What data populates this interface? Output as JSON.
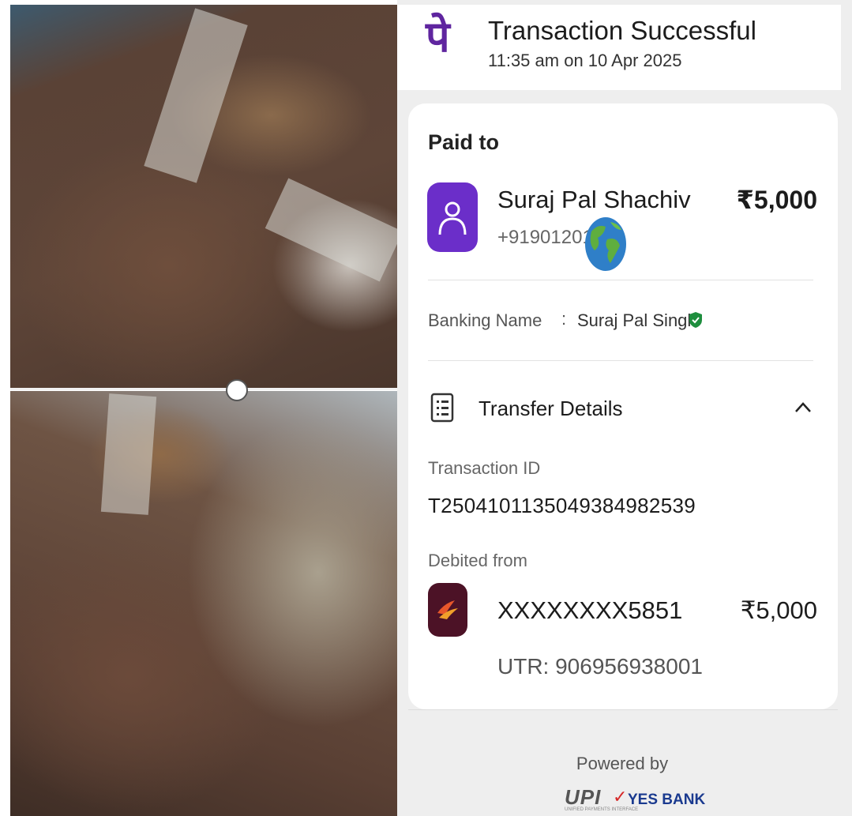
{
  "header": {
    "logo_glyph": "पे",
    "title": "Transaction Successful",
    "timestamp": "11:35 am on 10 Apr 2025"
  },
  "paid_to": {
    "label": "Paid to",
    "name": "Suraj Pal Shachiv",
    "phone": "+91901201",
    "amount": "₹5,000",
    "banking_name_label": "Banking Name",
    "banking_name_colon": ":",
    "banking_name_value": "Suraj Pal Singh"
  },
  "transfer_details": {
    "title": "Transfer Details",
    "transaction_id_label": "Transaction ID",
    "transaction_id": "T2504101135049384982539",
    "debited_from_label": "Debited from",
    "account": "XXXXXXXX5851",
    "amount": "₹5,000",
    "utr": "UTR: 906956938001"
  },
  "footer": {
    "powered_by": "Powered by",
    "upi": "UPI",
    "upi_sub": "UNIFIED PAYMENTS INTERFACE",
    "bank": "YES BANK"
  },
  "colors": {
    "brand_purple": "#5f259f",
    "avatar_purple": "#6b2ec9",
    "verified_green": "#1e8e3e",
    "bank_maroon": "#4c1226"
  },
  "icons": [
    "phonepe-logo",
    "person-icon",
    "globe-icon",
    "verified-shield-icon",
    "receipt-icon",
    "chevron-up-icon",
    "bank-logo-icon"
  ]
}
